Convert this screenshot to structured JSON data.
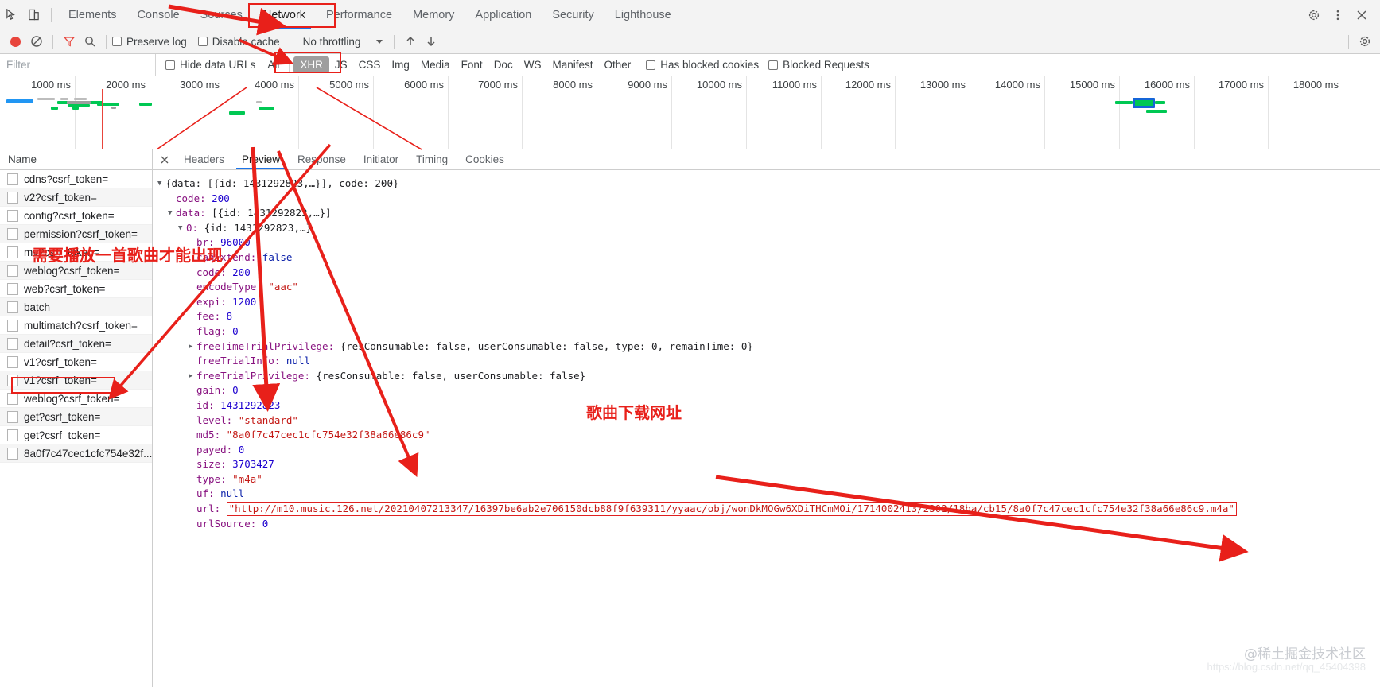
{
  "devtools": {
    "tabs": [
      {
        "label": "Elements",
        "active": false
      },
      {
        "label": "Console",
        "active": false
      },
      {
        "label": "Sources",
        "active": false
      },
      {
        "label": "Network",
        "active": true
      },
      {
        "label": "Performance",
        "active": false
      },
      {
        "label": "Memory",
        "active": false
      },
      {
        "label": "Application",
        "active": false
      },
      {
        "label": "Security",
        "active": false
      },
      {
        "label": "Lighthouse",
        "active": false
      }
    ],
    "icons": {
      "inspect": "inspect-element-icon",
      "device": "device-toolbar-icon",
      "settings": "gear-icon",
      "more": "more-vertical-icon",
      "close": "close-icon"
    }
  },
  "toolbar": {
    "record_label": "record-button",
    "clear_label": "clear-button",
    "filter_label": "filter-button",
    "search_label": "search-button",
    "preserve_log": "Preserve log",
    "disable_cache": "Disable cache",
    "throttling": "No throttling",
    "import_har": "import-har-icon",
    "export_har": "export-har-icon",
    "settings": "network-settings-icon"
  },
  "filterbar": {
    "placeholder": "Filter",
    "hide_data_urls": "Hide data URLs",
    "types": [
      {
        "label": "All",
        "selected": false
      },
      {
        "label": "XHR",
        "selected": true
      },
      {
        "label": "JS",
        "selected": false
      },
      {
        "label": "CSS",
        "selected": false
      },
      {
        "label": "Img",
        "selected": false
      },
      {
        "label": "Media",
        "selected": false
      },
      {
        "label": "Font",
        "selected": false
      },
      {
        "label": "Doc",
        "selected": false
      },
      {
        "label": "WS",
        "selected": false
      },
      {
        "label": "Manifest",
        "selected": false
      },
      {
        "label": "Other",
        "selected": false
      }
    ],
    "has_blocked_cookies": "Has blocked cookies",
    "blocked_requests": "Blocked Requests"
  },
  "overview": {
    "ticks": [
      "1000 ms",
      "2000 ms",
      "3000 ms",
      "4000 ms",
      "5000 ms",
      "6000 ms",
      "7000 ms",
      "8000 ms",
      "9000 ms",
      "10000 ms",
      "11000 ms",
      "12000 ms",
      "13000 ms",
      "14000 ms",
      "15000 ms",
      "16000 ms",
      "17000 ms",
      "18000 ms"
    ],
    "colors": {
      "bar_green": "#00c853",
      "bar_blue": "#2196f3",
      "dom_content_loaded": "#1a73e8",
      "load_event": "#e8453c"
    }
  },
  "requests": {
    "column_header": "Name",
    "items": [
      {
        "name": "cdns?csrf_token="
      },
      {
        "name": "v2?csrf_token="
      },
      {
        "name": "config?csrf_token="
      },
      {
        "name": "permission?csrf_token="
      },
      {
        "name": "mv?csrf_token="
      },
      {
        "name": "weblog?csrf_token="
      },
      {
        "name": "web?csrf_token="
      },
      {
        "name": "batch"
      },
      {
        "name": "multimatch?csrf_token="
      },
      {
        "name": "detail?csrf_token="
      },
      {
        "name": "v1?csrf_token="
      },
      {
        "name": "v1?csrf_token="
      },
      {
        "name": "weblog?csrf_token="
      },
      {
        "name": "get?csrf_token="
      },
      {
        "name": "get?csrf_token="
      },
      {
        "name": "8a0f7c47cec1cfc754e32f..."
      }
    ],
    "selected_index": 11
  },
  "detail": {
    "tabs": [
      {
        "label": "Headers",
        "active": false
      },
      {
        "label": "Preview",
        "active": true
      },
      {
        "label": "Response",
        "active": false
      },
      {
        "label": "Initiator",
        "active": false
      },
      {
        "label": "Timing",
        "active": false
      },
      {
        "label": "Cookies",
        "active": false
      }
    ],
    "close": "close-detail-icon"
  },
  "preview": {
    "lines": [
      {
        "indent": 0,
        "tri": "down",
        "parts": [
          {
            "t": "{data: [{id: 1431292823,…}], code: 200}",
            "c": "pl"
          }
        ]
      },
      {
        "indent": 1,
        "tri": "none",
        "parts": [
          {
            "t": "code: ",
            "c": "k"
          },
          {
            "t": "200",
            "c": "num"
          }
        ]
      },
      {
        "indent": 1,
        "tri": "down",
        "parts": [
          {
            "t": "data: ",
            "c": "k"
          },
          {
            "t": "[{id: 1431292823,…}]",
            "c": "pl"
          }
        ]
      },
      {
        "indent": 2,
        "tri": "down",
        "parts": [
          {
            "t": "0: ",
            "c": "k"
          },
          {
            "t": "{id: 1431292823,…}",
            "c": "pl"
          }
        ]
      },
      {
        "indent": 3,
        "tri": "none",
        "parts": [
          {
            "t": "br: ",
            "c": "k"
          },
          {
            "t": "96000",
            "c": "num"
          }
        ]
      },
      {
        "indent": 3,
        "tri": "none",
        "parts": [
          {
            "t": "canExtend: ",
            "c": "k"
          },
          {
            "t": "false",
            "c": "kw"
          }
        ]
      },
      {
        "indent": 3,
        "tri": "none",
        "parts": [
          {
            "t": "code: ",
            "c": "k"
          },
          {
            "t": "200",
            "c": "num"
          }
        ]
      },
      {
        "indent": 3,
        "tri": "none",
        "parts": [
          {
            "t": "encodeType: ",
            "c": "k"
          },
          {
            "t": "\"aac\"",
            "c": "str"
          }
        ]
      },
      {
        "indent": 3,
        "tri": "none",
        "parts": [
          {
            "t": "expi: ",
            "c": "k"
          },
          {
            "t": "1200",
            "c": "num"
          }
        ]
      },
      {
        "indent": 3,
        "tri": "none",
        "parts": [
          {
            "t": "fee: ",
            "c": "k"
          },
          {
            "t": "8",
            "c": "num"
          }
        ]
      },
      {
        "indent": 3,
        "tri": "none",
        "parts": [
          {
            "t": "flag: ",
            "c": "k"
          },
          {
            "t": "0",
            "c": "num"
          }
        ]
      },
      {
        "indent": 3,
        "tri": "right",
        "parts": [
          {
            "t": "freeTimeTrialPrivilege: ",
            "c": "k"
          },
          {
            "t": "{resConsumable: false, userConsumable: false, type: 0, remainTime: 0}",
            "c": "pl"
          }
        ]
      },
      {
        "indent": 3,
        "tri": "none",
        "parts": [
          {
            "t": "freeTrialInfo: ",
            "c": "k"
          },
          {
            "t": "null",
            "c": "kw"
          }
        ]
      },
      {
        "indent": 3,
        "tri": "right",
        "parts": [
          {
            "t": "freeTrialPrivilege: ",
            "c": "k"
          },
          {
            "t": "{resConsumable: false, userConsumable: false}",
            "c": "pl"
          }
        ]
      },
      {
        "indent": 3,
        "tri": "none",
        "parts": [
          {
            "t": "gain: ",
            "c": "k"
          },
          {
            "t": "0",
            "c": "num"
          }
        ]
      },
      {
        "indent": 3,
        "tri": "none",
        "parts": [
          {
            "t": "id: ",
            "c": "k"
          },
          {
            "t": "1431292823",
            "c": "num"
          }
        ]
      },
      {
        "indent": 3,
        "tri": "none",
        "parts": [
          {
            "t": "level: ",
            "c": "k"
          },
          {
            "t": "\"standard\"",
            "c": "str"
          }
        ]
      },
      {
        "indent": 3,
        "tri": "none",
        "parts": [
          {
            "t": "md5: ",
            "c": "k"
          },
          {
            "t": "\"8a0f7c47cec1cfc754e32f38a66e86c9\"",
            "c": "str"
          }
        ]
      },
      {
        "indent": 3,
        "tri": "none",
        "parts": [
          {
            "t": "payed: ",
            "c": "k"
          },
          {
            "t": "0",
            "c": "num"
          }
        ]
      },
      {
        "indent": 3,
        "tri": "none",
        "parts": [
          {
            "t": "size: ",
            "c": "k"
          },
          {
            "t": "3703427",
            "c": "num"
          }
        ]
      },
      {
        "indent": 3,
        "tri": "none",
        "parts": [
          {
            "t": "type: ",
            "c": "k"
          },
          {
            "t": "\"m4a\"",
            "c": "str"
          }
        ]
      },
      {
        "indent": 3,
        "tri": "none",
        "parts": [
          {
            "t": "uf: ",
            "c": "k"
          },
          {
            "t": "null",
            "c": "kw"
          }
        ]
      },
      {
        "indent": 3,
        "tri": "none",
        "highlight": true,
        "parts": [
          {
            "t": "url: ",
            "c": "k"
          },
          {
            "t": "\"http://m10.music.126.net/20210407213347/16397be6ab2e706150dcb88f9f639311/yyaac/obj/wonDkMOGw6XDiTHCmMOi/1714002413/2302/18ba/cb15/8a0f7c47cec1cfc754e32f38a66e86c9.m4a\"",
            "c": "str",
            "boxed": true
          }
        ]
      },
      {
        "indent": 3,
        "tri": "none",
        "parts": [
          {
            "t": "urlSource: ",
            "c": "k"
          },
          {
            "t": "0",
            "c": "num"
          }
        ]
      }
    ]
  },
  "annotations": {
    "note_play_song": "需要播放一首歌曲才能出现",
    "note_download_url": "歌曲下载网址",
    "color": "#e8201a"
  },
  "watermark": {
    "handle": "@稀土掘金技术社区",
    "url": "https://blog.csdn.net/qq_45404398"
  }
}
